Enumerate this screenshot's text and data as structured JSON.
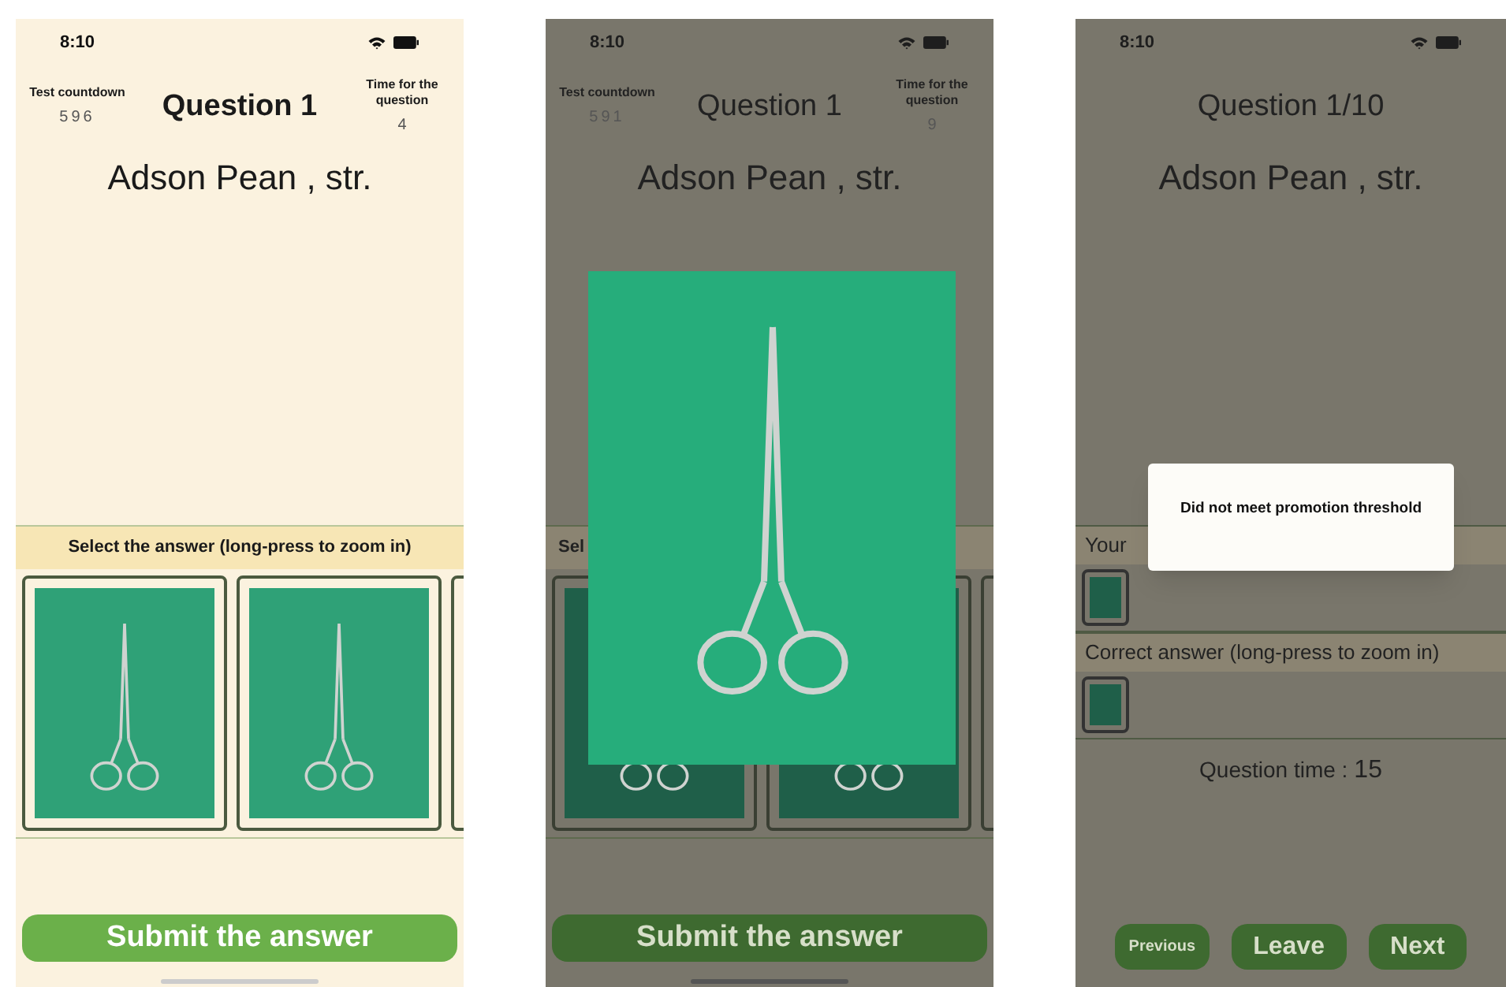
{
  "screens": [
    {
      "kind": "question",
      "dimmed": false,
      "status_time": "8:10",
      "countdown": {
        "label": "Test countdown",
        "value": "596"
      },
      "title": "Question 1",
      "timer": {
        "label": "Time for the question",
        "value": "4"
      },
      "instrument": "Adson Pean , str.",
      "answer_header": "Select the answer (long-press to zoom in)",
      "zoom_open": false,
      "submit": "Submit the answer"
    },
    {
      "kind": "question",
      "dimmed": true,
      "status_time": "8:10",
      "countdown": {
        "label": "Test countdown",
        "value": "591"
      },
      "title": "Question 1",
      "timer": {
        "label": "Time for the question",
        "value": "9"
      },
      "instrument": "Adson Pean , str.",
      "answer_header": "Sel",
      "zoom_open": true,
      "submit": "Submit the answer"
    },
    {
      "kind": "review",
      "dimmed": true,
      "status_time": "8:10",
      "title": "Question 1/10",
      "instrument": "Adson Pean , str.",
      "sections": [
        {
          "header": "Your"
        },
        {
          "header": "Correct answer (long-press to zoom in)"
        }
      ],
      "question_time": {
        "label": "Question time :",
        "value": "15"
      },
      "dialog": {
        "message": "Did not meet promotion threshold"
      },
      "buttons": [
        "Previous",
        "Leave",
        "Next"
      ]
    }
  ]
}
